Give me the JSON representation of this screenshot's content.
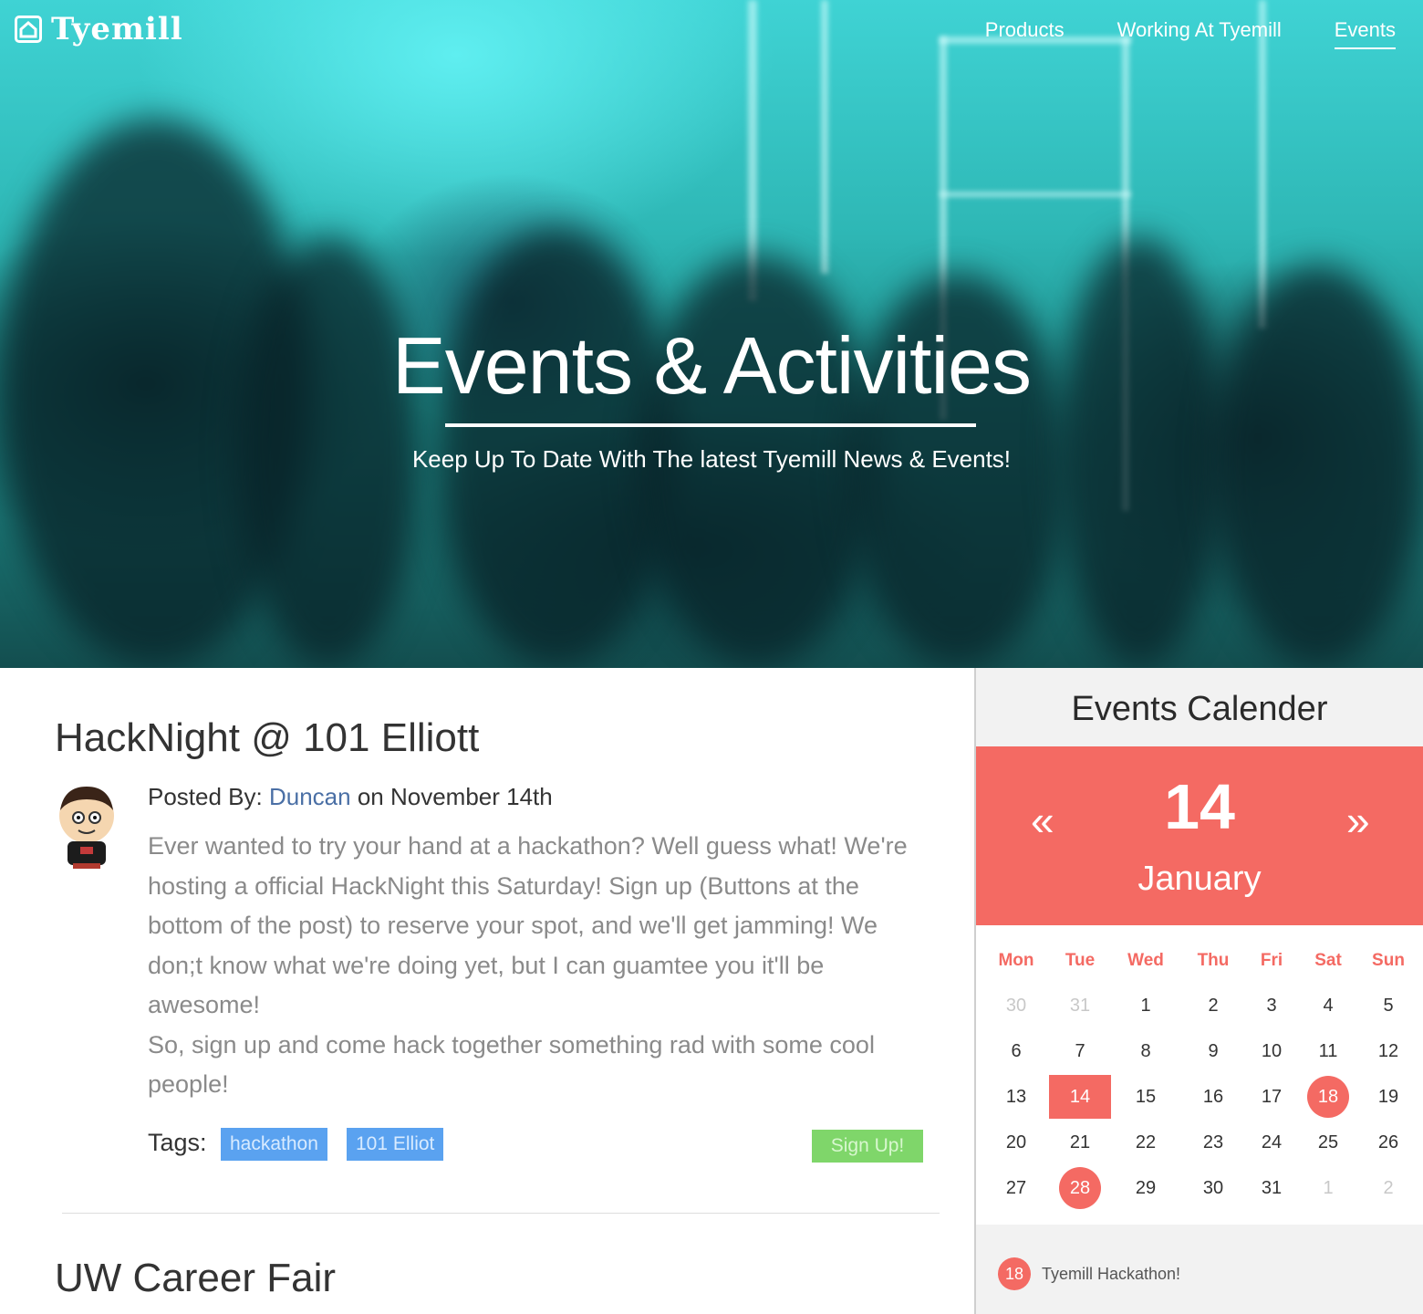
{
  "brand": {
    "name": "Tyemill"
  },
  "nav": [
    {
      "label": "Products",
      "active": false
    },
    {
      "label": "Working At Tyemill",
      "active": false
    },
    {
      "label": "Events",
      "active": true
    }
  ],
  "hero": {
    "title": "Events & Activities",
    "subtitle": "Keep Up To Date With The latest Tyemill News & Events!"
  },
  "posts": [
    {
      "title": "HackNight @ 101 Elliott",
      "posted_by_label": "Posted By:",
      "author": "Duncan",
      "date_text": "on November 14th",
      "body_lines": [
        "Ever wanted to try your hand at a hackathon? Well guess what! We're",
        "hosting a official HackNight this Saturday! Sign up (Buttons at the",
        "bottom of the post) to reserve your spot, and we'll get jamming! We",
        "don;t know what we're doing yet, but I can guamtee you it'll be",
        "awesome!",
        "So, sign up and come hack together something rad with some cool",
        "people!"
      ],
      "tags_label": "Tags:",
      "tags": [
        "hackathon",
        "101 Elliot"
      ],
      "signup_label": "Sign Up!"
    },
    {
      "title": "UW Career Fair"
    }
  ],
  "calendar": {
    "title": "Events Calender",
    "day": "14",
    "month": "January",
    "prev_symbol": "«",
    "next_symbol": "»",
    "weekdays": [
      "Mon",
      "Tue",
      "Wed",
      "Thu",
      "Fri",
      "Sat",
      "Sun"
    ],
    "weeks": [
      [
        "30",
        "31",
        "1",
        "2",
        "3",
        "4",
        "5"
      ],
      [
        "6",
        "7",
        "8",
        "9",
        "10",
        "11",
        "12"
      ],
      [
        "13",
        "14",
        "15",
        "16",
        "17",
        "18",
        "19"
      ],
      [
        "20",
        "21",
        "22",
        "23",
        "24",
        "25",
        "26"
      ],
      [
        "27",
        "28",
        "29",
        "30",
        "31",
        "1",
        "2"
      ]
    ],
    "muted_days": [
      "30",
      "31",
      "1",
      "2"
    ],
    "selected_day": "14",
    "event_days": [
      "18",
      "28"
    ],
    "event_list": [
      {
        "day": "18",
        "label": "Tyemill Hackathon!"
      }
    ]
  },
  "colors": {
    "accent": "#f46a63",
    "tag": "#5aa2f0",
    "signup": "#7fd66a",
    "author_link": "#4a6fa5"
  }
}
